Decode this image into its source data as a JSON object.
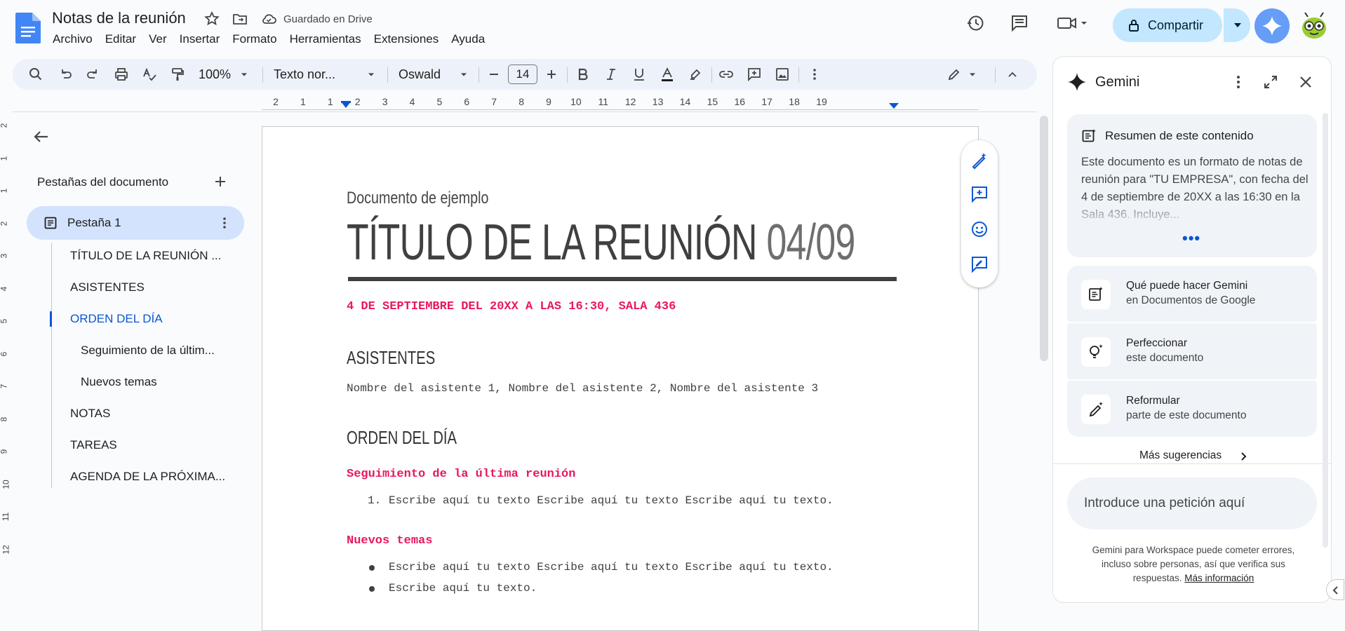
{
  "app": {
    "doc_title": "Notas de la reunión",
    "save_status": "Guardado en Drive",
    "menu": [
      "Archivo",
      "Editar",
      "Ver",
      "Insertar",
      "Formato",
      "Herramientas",
      "Extensiones",
      "Ayuda"
    ],
    "share_label": "Compartir",
    "accent": "#0b57d0",
    "share_bg": "#c2e7ff"
  },
  "toolbar": {
    "zoom": "100%",
    "style": "Texto nor...",
    "font": "Oswald",
    "font_size": "14"
  },
  "ruler": {
    "ticks": [
      "2",
      "1",
      "1",
      "2",
      "3",
      "4",
      "5",
      "6",
      "7",
      "8",
      "9",
      "10",
      "11",
      "12",
      "13",
      "14",
      "15",
      "16",
      "17",
      "18",
      "19"
    ],
    "vticks": [
      "2",
      "1",
      "1",
      "2",
      "3",
      "4",
      "5",
      "6",
      "7",
      "8",
      "9",
      "10",
      "11",
      "12"
    ]
  },
  "tabs_panel": {
    "title": "Pestañas del documento",
    "tab_label": "Pestaña 1",
    "outline": [
      {
        "label": "TÍTULO DE LA REUNIÓN ..."
      },
      {
        "label": "ASISTENTES"
      },
      {
        "label": "ORDEN DEL DÍA",
        "active": true
      },
      {
        "label": "Seguimiento de la últim..."
      },
      {
        "label": "Nuevos temas"
      },
      {
        "label": "NOTAS"
      },
      {
        "label": "TAREAS"
      },
      {
        "label": "AGENDA DE LA PRÓXIMA..."
      }
    ]
  },
  "document": {
    "subtitle": "Documento de ejemplo",
    "title": "TÍTULO DE LA REUNIÓN",
    "title_date": "04/09",
    "date_line": "4 DE SEPTIEMBRE DEL 20XX A LAS 16:30, SALA 436",
    "h_attendees": "ASISTENTES",
    "attendees": "Nombre del asistente 1, Nombre del asistente 2, Nombre del asistente 3",
    "h_agenda": "ORDEN DEL DÍA",
    "h_followup": "Seguimiento de la última reunión",
    "followup_num": "1.",
    "followup_item": "Escribe aquí tu texto Escribe aquí tu texto Escribe aquí tu texto.",
    "h_new": "Nuevos temas",
    "new_items": [
      "Escribe aquí tu texto Escribe aquí tu texto Escribe aquí tu texto.",
      "Escribe aquí tu texto."
    ],
    "accent_pink": "#e8185f"
  },
  "gemini": {
    "title": "Gemini",
    "summary_title": "Resumen de este contenido",
    "summary_text": "Este documento es un formato de notas de reunión para \"TU EMPRESA\", con fecha del 4 de septiembre de 20XX a las 16:30 en la Sala 436. Incluye...",
    "summary_more": "•••",
    "suggestions": [
      {
        "title": "Qué puede hacer Gemini",
        "sub": "en Documentos de Google"
      },
      {
        "title": "Perfeccionar",
        "sub": "este documento"
      },
      {
        "title": "Reformular",
        "sub": "parte de este documento"
      }
    ],
    "more_suggestions": "Más sugerencias",
    "prompt_placeholder": "Introduce una petición aquí",
    "disclaimer": "Gemini para Workspace puede cometer errores, incluso sobre personas, así que verifica sus respuestas.",
    "disclaimer_link": "Más información"
  }
}
